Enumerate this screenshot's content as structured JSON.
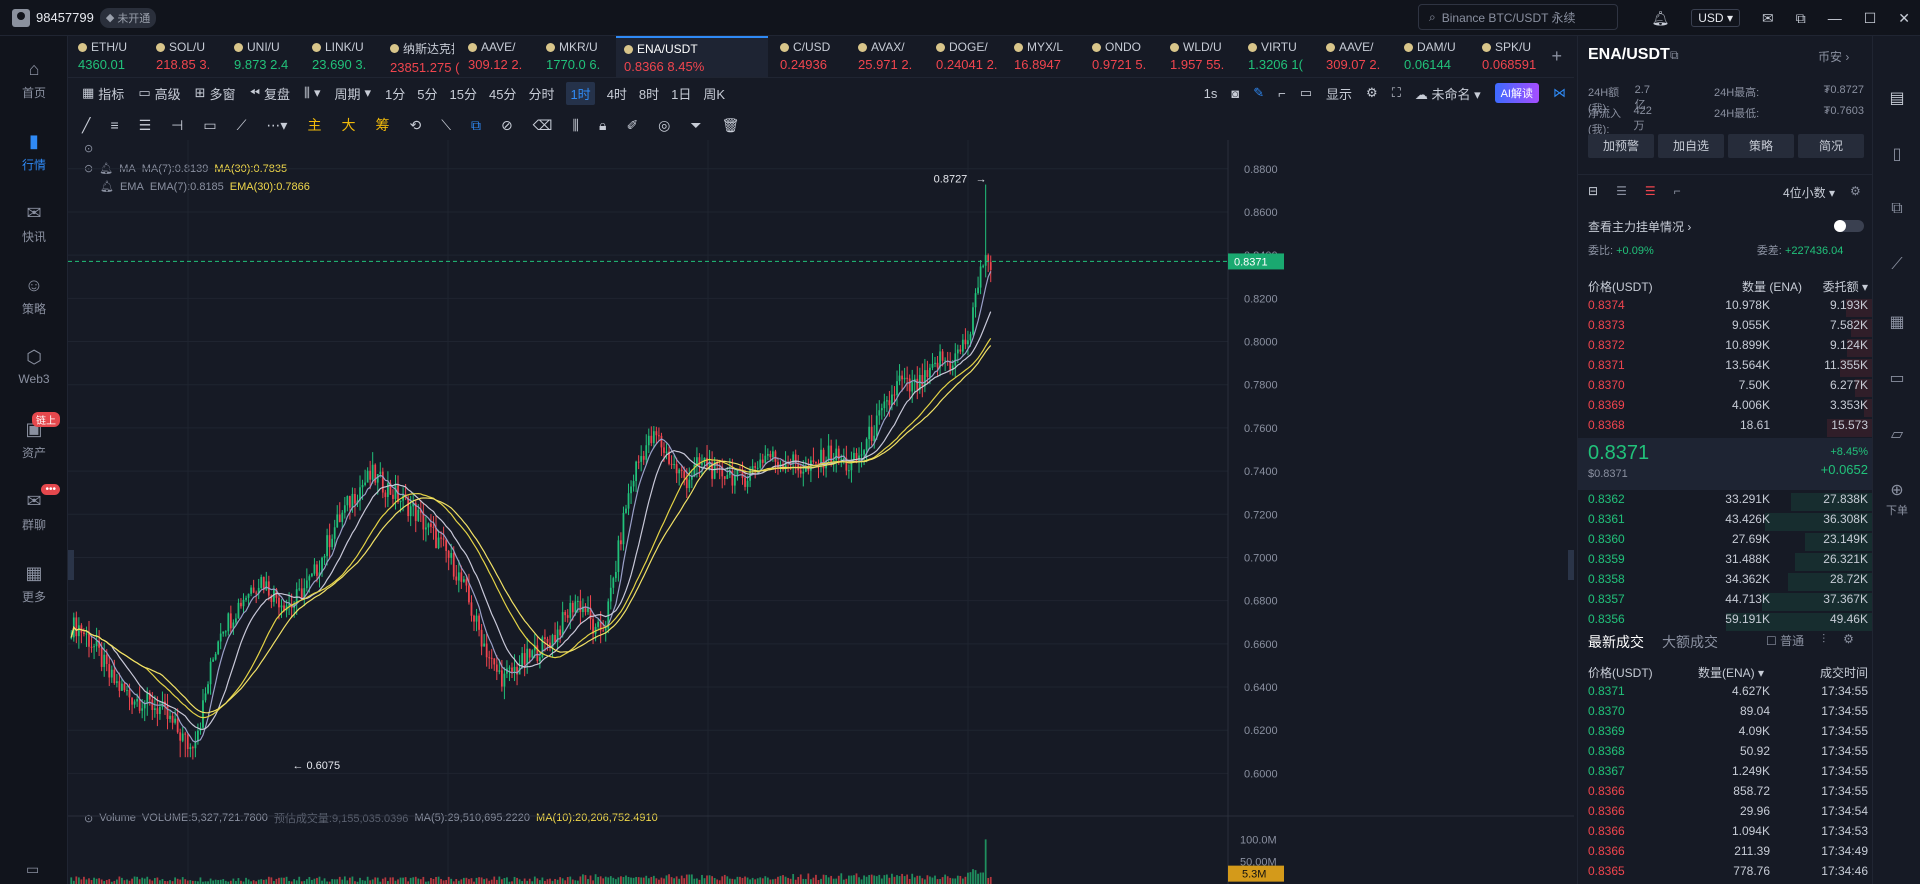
{
  "titlebar": {
    "account": "98457799",
    "vip": "未开通",
    "search_placeholder": "Binance BTC/USDT 永续",
    "currency": "USD"
  },
  "sidebar": [
    {
      "label": "首页",
      "icon": "home-icon"
    },
    {
      "label": "行情",
      "icon": "market-chart-icon",
      "active": true
    },
    {
      "label": "快讯",
      "icon": "news-icon"
    },
    {
      "label": "策略",
      "icon": "robot-icon"
    },
    {
      "label": "Web3",
      "icon": "web3-icon"
    },
    {
      "label": "资产",
      "icon": "wallet-icon",
      "badge": "链上"
    },
    {
      "label": "群聊",
      "icon": "chat-icon",
      "badge": "•••"
    },
    {
      "label": "更多",
      "icon": "grid-icon"
    }
  ],
  "tickers": [
    {
      "name": "ETH/U",
      "price": "4360.01",
      "change": "",
      "dir": "up"
    },
    {
      "name": "SOL/U",
      "price": "218.85",
      "change": "3.",
      "dir": "dn"
    },
    {
      "name": "UNI/U",
      "price": "9.873",
      "change": "2.4",
      "dir": "up"
    },
    {
      "name": "LINK/U",
      "price": "23.690",
      "change": "3.",
      "dir": "up"
    },
    {
      "name": "纳斯达克指",
      "price": "23851.275",
      "change": "(",
      "dir": "dn"
    },
    {
      "name": "AAVE/",
      "price": "309.12",
      "change": "2.",
      "dir": "dn"
    },
    {
      "name": "MKR/U",
      "price": "1770.0",
      "change": "6.",
      "dir": "up"
    },
    {
      "name": "ENA/USDT",
      "price": "0.8366",
      "change": "8.45%",
      "dir": "dn",
      "selected": true
    },
    {
      "name": "C/USD",
      "price": "0.24936",
      "change": "",
      "dir": "dn"
    },
    {
      "name": "AVAX/",
      "price": "25.971",
      "change": "2.",
      "dir": "dn"
    },
    {
      "name": "DOGE/",
      "price": "0.24041",
      "change": "2.",
      "dir": "dn"
    },
    {
      "name": "MYX/L",
      "price": "16.8947",
      "change": "",
      "dir": "dn"
    },
    {
      "name": "ONDO",
      "price": "0.9721",
      "change": "5.",
      "dir": "dn"
    },
    {
      "name": "WLD/U",
      "price": "1.957",
      "change": "55.",
      "dir": "dn"
    },
    {
      "name": "VIRTU",
      "price": "1.3206",
      "change": "1(",
      "dir": "up"
    },
    {
      "name": "AAVE/",
      "price": "309.07",
      "change": "2.",
      "dir": "dn"
    },
    {
      "name": "DAM/U",
      "price": "0.06144",
      "change": "",
      "dir": "up"
    },
    {
      "name": "SPK/U",
      "price": "0.068591",
      "change": "",
      "dir": "dn"
    }
  ],
  "toolbar1": {
    "items": [
      "指标",
      "高级",
      "多窗",
      "复盘"
    ],
    "period_label": "周期",
    "periods": [
      "1分",
      "5分",
      "15分",
      "45分",
      "分时",
      "1时",
      "4时",
      "8时",
      "1日",
      "周K"
    ],
    "active_period": "1时",
    "right": {
      "interval": "1s",
      "display": "显示",
      "layout_name": "未命名",
      "ai": "AI解读"
    }
  },
  "toolbar2": {
    "drawing_tags": [
      "主",
      "大",
      "筹"
    ]
  },
  "indicators": {
    "ma": {
      "name": "MA",
      "ma7": "MA(7):0.8139",
      "ma30": "MA(30):0.7835"
    },
    "ema": {
      "name": "EMA",
      "ema7": "EMA(7):0.8185",
      "ema30": "EMA(30):0.7866"
    },
    "volume": {
      "name": "Volume",
      "vol": "VOLUME:5,327,721.7800",
      "forecast": "预估成交量:9,155,035.0396",
      "ma5": "MA(5):29,510,695.2220",
      "ma10": "MA(10):20,206,752.4910"
    }
  },
  "chart_data": {
    "type": "candlestick",
    "symbol": "ENA/USDT",
    "interval": "1时",
    "ylim": [
      0.59,
      0.885
    ],
    "y_ticks": [
      "0.8800",
      "0.8600",
      "0.8400",
      "0.8200",
      "0.8000",
      "0.7800",
      "0.7600",
      "0.7400",
      "0.7200",
      "0.7000",
      "0.6800",
      "0.6600",
      "0.6400",
      "0.6200",
      "0.6000"
    ],
    "last_price": "0.8371",
    "high_label": "0.8727",
    "low_label": "0.6075",
    "close_path": [
      0.668,
      0.662,
      0.655,
      0.645,
      0.64,
      0.636,
      0.634,
      0.632,
      0.63,
      0.624,
      0.618,
      0.612,
      0.625,
      0.648,
      0.668,
      0.672,
      0.68,
      0.686,
      0.69,
      0.684,
      0.68,
      0.678,
      0.684,
      0.69,
      0.7,
      0.712,
      0.72,
      0.728,
      0.734,
      0.738,
      0.734,
      0.73,
      0.726,
      0.722,
      0.716,
      0.71,
      0.704,
      0.696,
      0.686,
      0.672,
      0.66,
      0.648,
      0.644,
      0.648,
      0.652,
      0.656,
      0.66,
      0.664,
      0.672,
      0.68,
      0.676,
      0.664,
      0.67,
      0.696,
      0.724,
      0.742,
      0.752,
      0.756,
      0.748,
      0.74,
      0.736,
      0.742,
      0.744,
      0.738,
      0.74,
      0.736,
      0.738,
      0.744,
      0.748,
      0.744,
      0.746,
      0.742,
      0.74,
      0.744,
      0.748,
      0.746,
      0.742,
      0.746,
      0.756,
      0.764,
      0.772,
      0.782,
      0.778,
      0.78,
      0.784,
      0.792,
      0.79,
      0.796,
      0.804,
      0.836,
      0.8371
    ],
    "volume_ylim": [
      0,
      130000000
    ],
    "volume_ticks": [
      "100.0M",
      "50.00M"
    ],
    "volume_last_label": "5.3M"
  },
  "right_panel": {
    "symbol": "ENA/USDT",
    "exchange": "币安",
    "stats": [
      {
        "k": "24H额(我):",
        "v": "2.7亿"
      },
      {
        "k": "24H最高:",
        "v": "₮0.8727"
      },
      {
        "k": "净流入(我):",
        "v": "422万"
      },
      {
        "k": "24H最低:",
        "v": "₮0.7603"
      }
    ],
    "actions": [
      "加预警",
      "加自选",
      "策略",
      "简况"
    ],
    "precision": "4位小数",
    "depth_link": "查看主力挂单情况",
    "ratio": {
      "k1": "委比:",
      "v1": "+0.09%",
      "k2": "委差:",
      "v2": "+227436.04"
    },
    "book_headers": [
      "价格(USDT)",
      "数量 (ENA)",
      "委托额"
    ],
    "asks": [
      [
        "0.8374",
        "10.978K",
        "9.193K"
      ],
      [
        "0.8373",
        "9.055K",
        "7.582K"
      ],
      [
        "0.8372",
        "10.899K",
        "9.124K"
      ],
      [
        "0.8371",
        "13.564K",
        "11.355K"
      ],
      [
        "0.8370",
        "7.50K",
        "6.277K"
      ],
      [
        "0.8369",
        "4.006K",
        "3.353K"
      ],
      [
        "0.8368",
        "18.61",
        "15.573"
      ]
    ],
    "mid": {
      "price": "0.8371",
      "usd": "$0.8371",
      "pct": "+8.45%",
      "chg": "+0.0652"
    },
    "bids": [
      [
        "0.8362",
        "33.291K",
        "27.838K"
      ],
      [
        "0.8361",
        "43.426K",
        "36.308K"
      ],
      [
        "0.8360",
        "27.69K",
        "23.149K"
      ],
      [
        "0.8359",
        "31.488K",
        "26.321K"
      ],
      [
        "0.8358",
        "34.362K",
        "28.72K"
      ],
      [
        "0.8357",
        "44.713K",
        "37.367K"
      ],
      [
        "0.8356",
        "59.191K",
        "49.46K"
      ]
    ],
    "trades_tabs": [
      "最新成交",
      "大额成交"
    ],
    "trades_toggle": "普通",
    "trade_headers": [
      "价格(USDT)",
      "数量(ENA)",
      "成交时间"
    ],
    "trades": [
      [
        "0.8371",
        "4.627K",
        "17:34:55",
        "up"
      ],
      [
        "0.8370",
        "89.04",
        "17:34:55",
        "up"
      ],
      [
        "0.8369",
        "4.09K",
        "17:34:55",
        "up"
      ],
      [
        "0.8368",
        "50.92",
        "17:34:55",
        "up"
      ],
      [
        "0.8367",
        "1.249K",
        "17:34:55",
        "up"
      ],
      [
        "0.8366",
        "858.72",
        "17:34:55",
        "dn"
      ],
      [
        "0.8366",
        "29.96",
        "17:34:54",
        "dn"
      ],
      [
        "0.8366",
        "1.094K",
        "17:34:53",
        "dn"
      ],
      [
        "0.8366",
        "211.39",
        "17:34:49",
        "dn"
      ],
      [
        "0.8365",
        "778.76",
        "17:34:46",
        "dn"
      ]
    ]
  },
  "right_toolbar": {
    "items": [
      {
        "icon": "orderbook-icon"
      },
      {
        "icon": "document-icon"
      },
      {
        "icon": "copy-icon"
      },
      {
        "icon": "chart-line-icon"
      },
      {
        "icon": "calculator-icon"
      },
      {
        "icon": "card-icon"
      },
      {
        "icon": "layers-icon"
      },
      {
        "icon": "order-icon",
        "label": "下单"
      }
    ]
  }
}
